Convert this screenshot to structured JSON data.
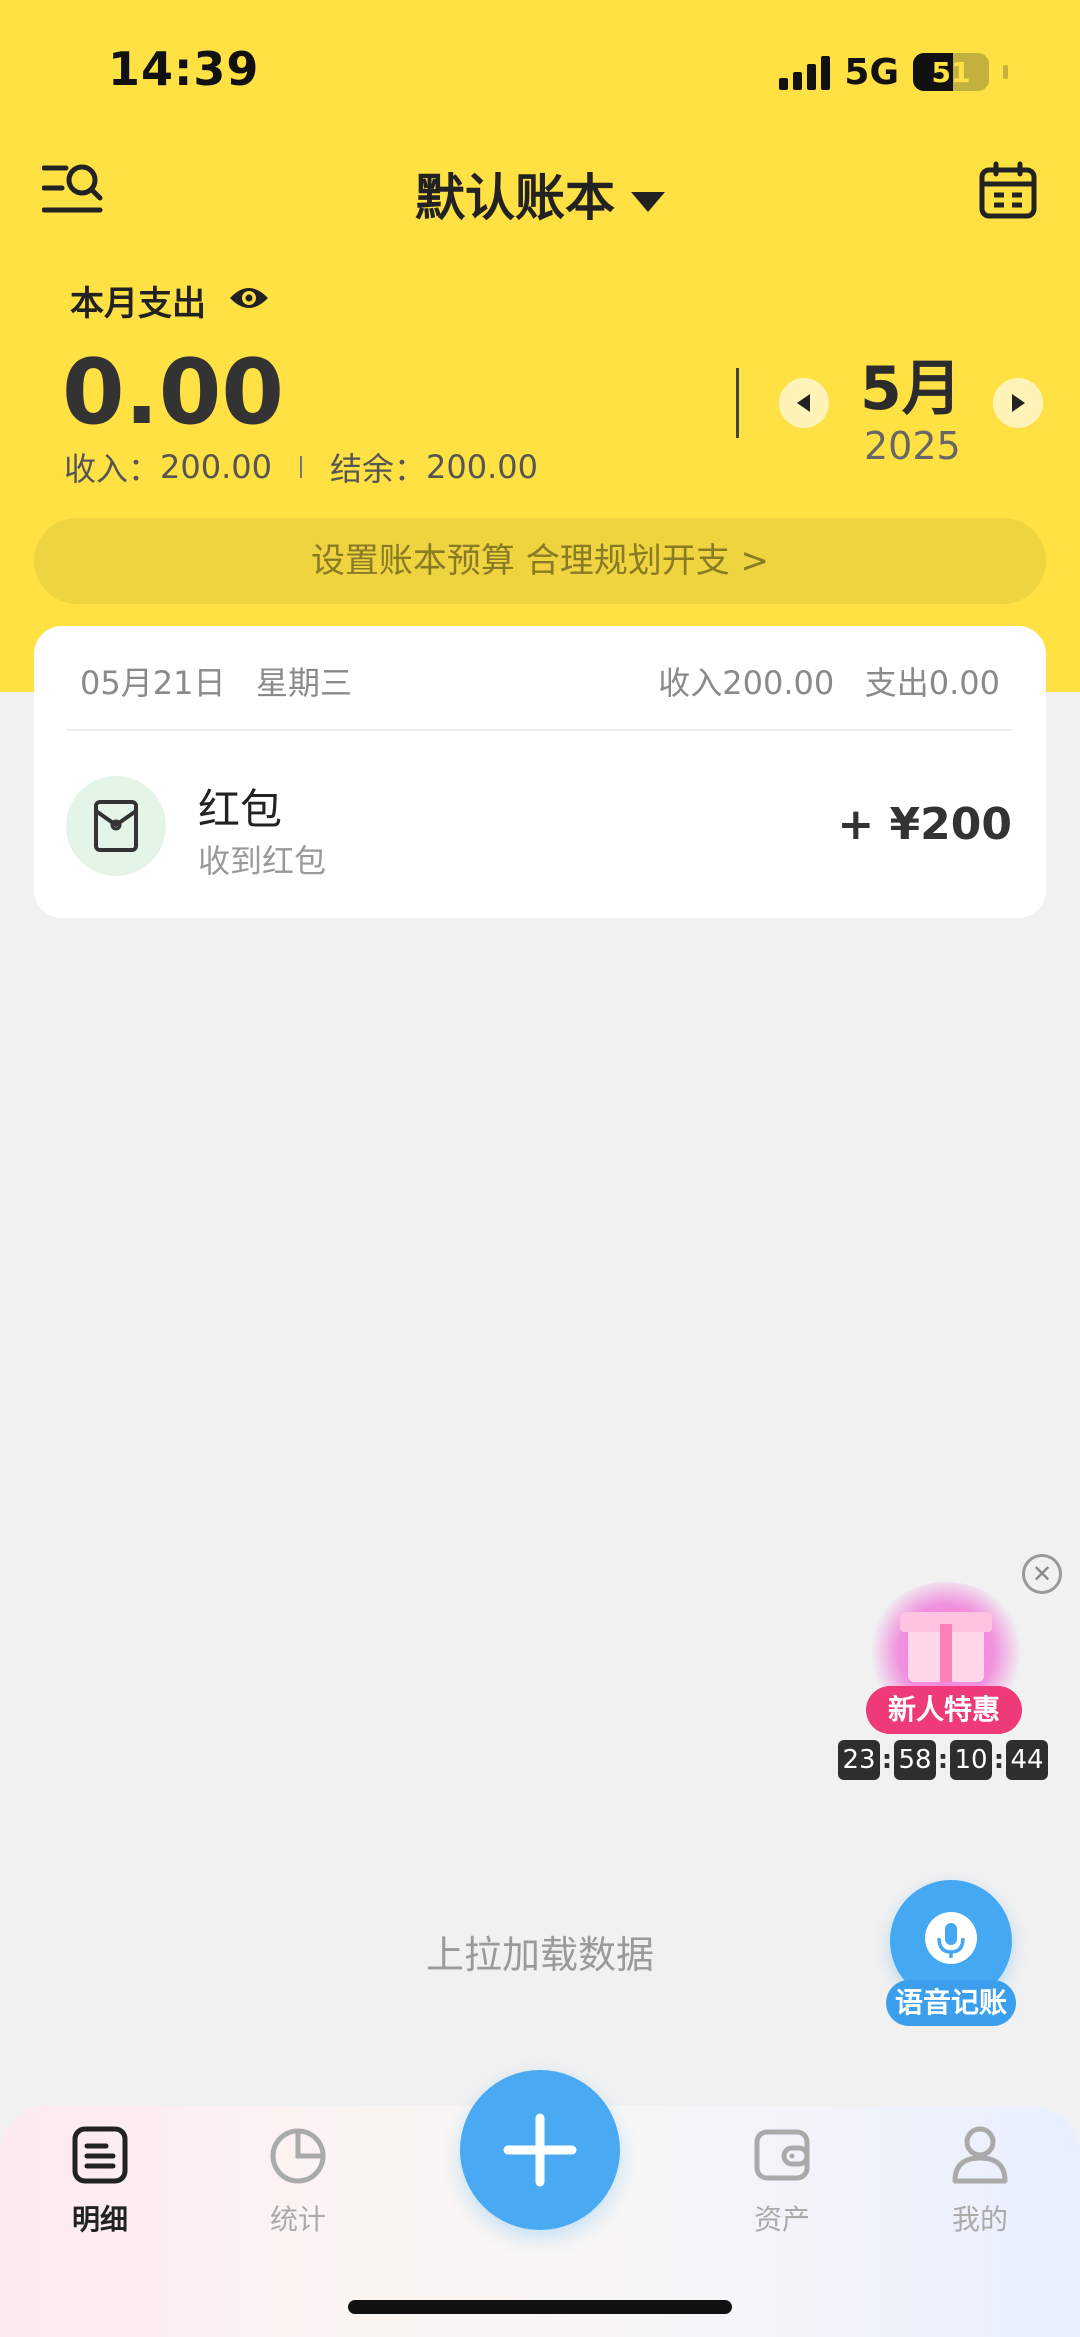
{
  "status_bar": {
    "time": "14:39",
    "network": "5G",
    "battery": "51"
  },
  "header": {
    "book_title": "默认账本"
  },
  "summary": {
    "label": "本月支出",
    "expense": "0.00",
    "income_label": "收入：",
    "income": "200.00",
    "balance_label": "结余：",
    "balance": "200.00",
    "month": "5月",
    "year": "2025"
  },
  "budget_banner": "设置账本预算 合理规划开支 >",
  "day_group": {
    "date": "05月21日",
    "weekday": "星期三",
    "income_total": "收入200.00",
    "expense_total": "支出0.00",
    "transactions": [
      {
        "category": "红包",
        "note": "收到红包",
        "amount": "+ ¥200",
        "icon": "red-envelope-icon"
      }
    ]
  },
  "promo": {
    "badge": "新人特惠",
    "countdown": [
      "23",
      "58",
      "10",
      "44"
    ]
  },
  "load_more": "上拉加载数据",
  "voice": {
    "label": "语音记账"
  },
  "tabs": [
    {
      "label": "明细",
      "icon": "list-icon"
    },
    {
      "label": "统计",
      "icon": "pie-chart-icon"
    },
    {
      "label": "资产",
      "icon": "wallet-icon"
    },
    {
      "label": "我的",
      "icon": "user-icon"
    }
  ],
  "colors": {
    "accent_yellow": "#ffe144",
    "accent_blue": "#4aa9f3",
    "promo_pink": "#ee3a78"
  }
}
